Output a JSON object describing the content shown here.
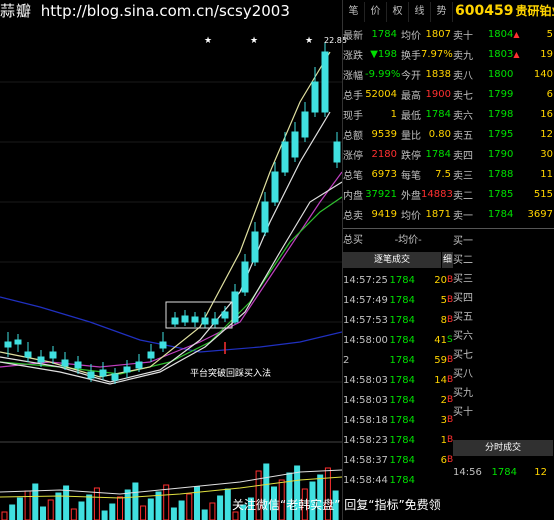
{
  "watermark": {
    "brand": "蒜瓣",
    "url": "http://blog.sina.com.cn/scsy2003"
  },
  "chart": {
    "peak_label": "22.85",
    "annotation": "平台突破回踩买入法",
    "flags": [
      "★",
      "★",
      "★"
    ]
  },
  "header": {
    "tabs": [
      "笔",
      "价",
      "权",
      "线",
      "势"
    ],
    "code": "600459",
    "name": "贵研铂业"
  },
  "quote": [
    {
      "l": "最新",
      "v": "1784",
      "l2": "均价",
      "v2": "1807",
      "vc": "green",
      "v2c": "yellow"
    },
    {
      "l": "涨跌",
      "v": "▼198",
      "l2": "换手",
      "v2": "7.97%",
      "vc": "green",
      "v2c": "yellow"
    },
    {
      "l": "涨幅",
      "v": "-9.99%",
      "l2": "今开",
      "v2": "1838",
      "vc": "green",
      "v2c": "yellow"
    },
    {
      "l": "总手",
      "v": "52004",
      "l2": "最高",
      "v2": "1900",
      "vc": "yellow",
      "v2c": "red"
    },
    {
      "l": "现手",
      "v": "1",
      "l2": "最低",
      "v2": "1784",
      "vc": "yellow",
      "v2c": "green"
    },
    {
      "l": "总额",
      "v": "9539",
      "l2": "量比",
      "v2": "0.80",
      "vc": "yellow",
      "v2c": "yellow"
    },
    {
      "l": "涨停",
      "v": "2180",
      "l2": "跌停",
      "v2": "1784",
      "vc": "red",
      "v2c": "green"
    },
    {
      "l": "总笔",
      "v": "6973",
      "l2": "每笔",
      "v2": "7.5",
      "vc": "yellow",
      "v2c": "yellow"
    },
    {
      "l": "内盘",
      "v": "37921",
      "l2": "外盘",
      "v2": "14883",
      "vc": "green",
      "v2c": "red"
    },
    {
      "l": "总卖",
      "v": "9419",
      "l2": "均价",
      "v2": "1871",
      "vc": "yellow",
      "v2c": "yellow"
    }
  ],
  "sells": [
    {
      "l": "卖十",
      "p": "1804",
      "d": "▲",
      "v": "5"
    },
    {
      "l": "卖九",
      "p": "1803",
      "d": "▲",
      "v": "19"
    },
    {
      "l": "卖八",
      "p": "1800",
      "d": "",
      "v": "140"
    },
    {
      "l": "卖七",
      "p": "1799",
      "d": "",
      "v": "6"
    },
    {
      "l": "卖六",
      "p": "1798",
      "d": "",
      "v": "16"
    },
    {
      "l": "卖五",
      "p": "1795",
      "d": "",
      "v": "12"
    },
    {
      "l": "卖四",
      "p": "1790",
      "d": "",
      "v": "30"
    },
    {
      "l": "卖三",
      "p": "1788",
      "d": "",
      "v": "11"
    },
    {
      "l": "卖二",
      "p": "1785",
      "d": "",
      "v": "515"
    },
    {
      "l": "卖一",
      "p": "1784",
      "d": "",
      "v": "3697"
    }
  ],
  "avg_row": {
    "l": "总买",
    "v": "-均价-"
  },
  "trades_header": "逐笔成交",
  "trades_side": "细",
  "trades": [
    {
      "t": "14:57:25",
      "p": "1784",
      "a": "20",
      "d": "B"
    },
    {
      "t": "14:57:49",
      "p": "1784",
      "a": "5",
      "d": "B"
    },
    {
      "t": "14:57:53",
      "p": "1784",
      "a": "8",
      "d": "B"
    },
    {
      "t": "14:58:00",
      "p": "1784",
      "a": "41",
      "d": "S"
    },
    {
      "t": "2",
      "p": "1784",
      "a": "59",
      "d": "B"
    },
    {
      "t": "14:58:03",
      "p": "1784",
      "a": "14",
      "d": "B"
    },
    {
      "t": "14:58:03",
      "p": "1784",
      "a": "2",
      "d": "B"
    },
    {
      "t": "14:58:18",
      "p": "1784",
      "a": "3",
      "d": "B"
    },
    {
      "t": "14:58:23",
      "p": "1784",
      "a": "1",
      "d": "B"
    },
    {
      "t": "14:58:37",
      "p": "1784",
      "a": "6",
      "d": "B"
    },
    {
      "t": "14:58:44",
      "p": "1784",
      "a": "",
      "d": ""
    }
  ],
  "buys": [
    "买一",
    "买二",
    "买三",
    "买四",
    "买五",
    "买六",
    "买七",
    "买八",
    "买九",
    "买十"
  ],
  "mini": {
    "header": "分时成交",
    "t": "14:56",
    "p": "1784",
    "a": "12"
  },
  "footer": "关注微信“老韩实盘” 回复“指标”免费领"
}
